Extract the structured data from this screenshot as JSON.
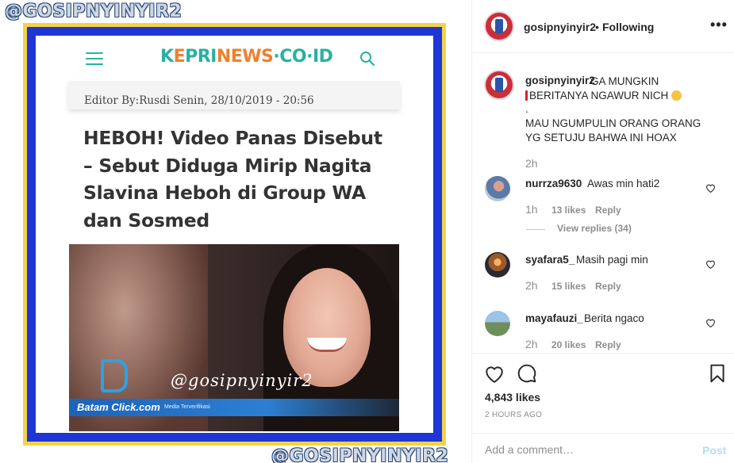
{
  "post_image": {
    "watermark_top": "@GOSIPNYINYIR2",
    "watermark_bottom": "@GOSIPNYINYIR2",
    "site_logo_part1": "K",
    "site_logo_accent": "E",
    "site_logo_part2": "PRI",
    "site_logo_part3": "NEWS",
    "site_logo_part4": "·CO·ID",
    "meta": "Editor By:Rusdi Senin, 28/10/2019 - 20:56",
    "headline": "HEBOH! Video Panas Disebut – Sebut Diduga Mirip Nagita Slavina Heboh di Group WA dan Sosmed",
    "photo_watermark": "@gosipnyinyir2",
    "source_brand": "Batam Click.com",
    "source_sub": "Media Terverifikasi"
  },
  "header": {
    "username": "gosipnyinyir2",
    "separator": "•",
    "follow_status": "Following",
    "more": "•••"
  },
  "caption": {
    "username": "gosipnyinyir2",
    "line1": "GA MUNGKIN",
    "line2": "BERITANYA NGAWUR NICH",
    "line3": ".",
    "line4": "MAU NGUMPULIN ORANG ORANG",
    "line5": "YG SETUJU BAHWA INI HOAX",
    "time": "2h"
  },
  "comments": [
    {
      "username": "nurrza9630",
      "text": "Awas min hati2",
      "time": "1h",
      "likes": "13 likes",
      "reply": "Reply",
      "view_replies": "View replies (34)"
    },
    {
      "username": "syafara5_",
      "text": "Masih pagi min",
      "time": "2h",
      "likes": "15 likes",
      "reply": "Reply"
    },
    {
      "username": "mayafauzi_",
      "text": "Berita ngaco",
      "time": "2h",
      "likes": "20 likes",
      "reply": "Reply"
    }
  ],
  "actions": {
    "likes": "4,843 likes",
    "posted_ago": "2 HOURS AGO"
  },
  "composer": {
    "placeholder": "Add a comment…",
    "post_label": "Post"
  },
  "colors": {
    "teal": "#29b0a3",
    "orange": "#f07f2d",
    "frame_blue": "#1e36d6",
    "frame_gold": "#f3d24a",
    "post_button_disabled": "#b2dffc"
  }
}
